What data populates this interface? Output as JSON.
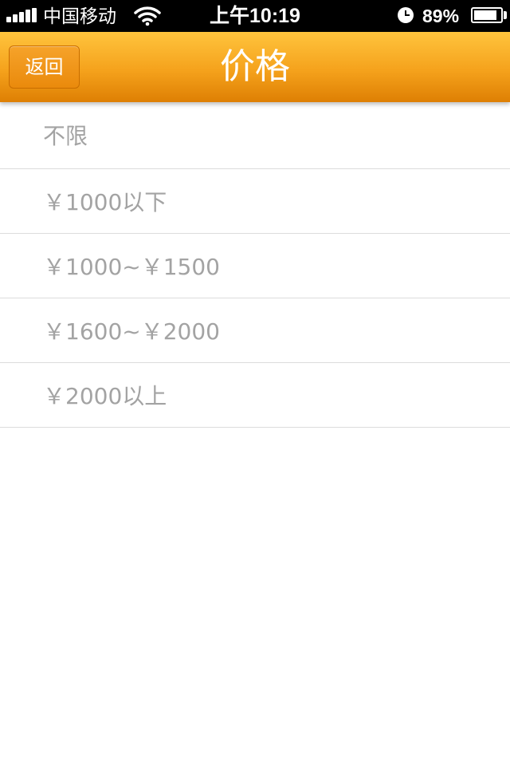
{
  "status_bar": {
    "carrier": "中国移动",
    "time": "上午10:19",
    "battery_percent": "89%",
    "battery_level": 0.89,
    "icons": [
      "signal-icon",
      "wifi-icon",
      "alarm-icon",
      "battery-icon"
    ]
  },
  "nav": {
    "back_label": "返回",
    "title": "价格"
  },
  "price_options": [
    {
      "label": "不限"
    },
    {
      "label": "￥1000以下"
    },
    {
      "label": "￥1000~￥1500"
    },
    {
      "label": "￥1600~￥2000"
    },
    {
      "label": "￥2000以上"
    }
  ],
  "colors": {
    "nav_top": "#ffc43d",
    "nav_bottom": "#de7f03",
    "item_text": "#a3a3a3",
    "divider": "#dcdcdc"
  }
}
